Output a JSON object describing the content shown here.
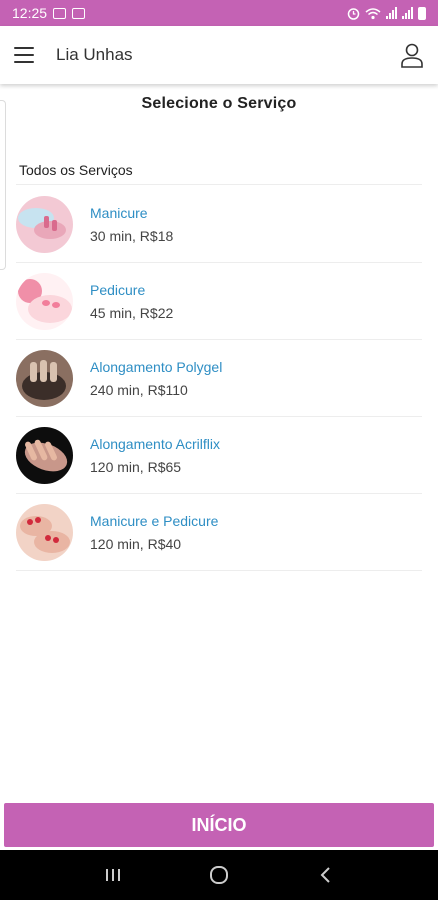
{
  "status_bar": {
    "time": "12:25",
    "background": "#c462b4",
    "left_icons": [
      "gallery-icon",
      "messenger-icon"
    ],
    "right_icons": [
      "alarm-icon",
      "wifi-icon",
      "signal-icon",
      "signal-icon",
      "battery-icon"
    ]
  },
  "app_bar": {
    "title": "Lia Unhas",
    "menu_icon": "hamburger-menu-icon",
    "profile_icon": "user-profile-icon"
  },
  "page": {
    "title": "Selecione o Serviço",
    "section_label": "Todos os Serviços"
  },
  "services": [
    {
      "name": "Manicure",
      "detail": "30 min, R$18",
      "thumb_colors": [
        "#f3c9d4",
        "#d96b8d",
        "#c7e3f0"
      ]
    },
    {
      "name": "Pedicure",
      "detail": "45 min, R$22",
      "thumb_colors": [
        "#fbd6dc",
        "#f08fa8",
        "#fff1f3"
      ]
    },
    {
      "name": "Alongamento Polygel",
      "detail": "240 min, R$110",
      "thumb_colors": [
        "#8a6f61",
        "#d9c2b0",
        "#3b2e29"
      ]
    },
    {
      "name": "Alongamento Acrilflix",
      "detail": "120 min, R$65",
      "thumb_colors": [
        "#0d0d0d",
        "#e6b8a2",
        "#c8978a"
      ]
    },
    {
      "name": "Manicure e Pedicure",
      "detail": "120 min, R$40",
      "thumb_colors": [
        "#f2d3c6",
        "#d12a3c",
        "#e9b5a3"
      ]
    }
  ],
  "footer": {
    "button_label": "INÍCIO",
    "button_color": "#c462b4"
  },
  "nav_bar": {
    "icons": [
      "recent-apps-icon",
      "home-icon",
      "back-icon"
    ]
  },
  "colors": {
    "accent": "#c462b4",
    "link": "#2e8ec4"
  }
}
